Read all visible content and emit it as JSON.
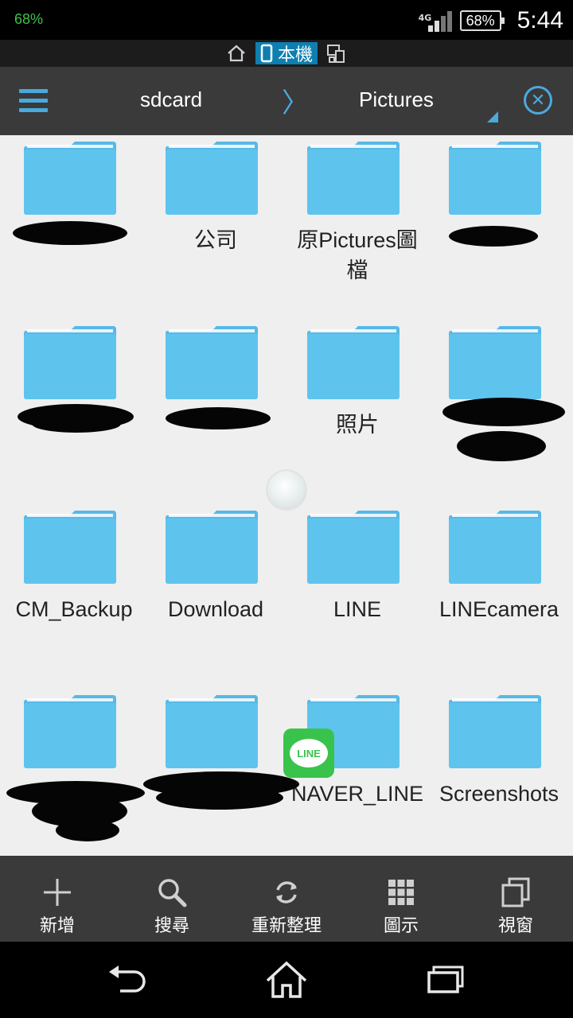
{
  "status_bar": {
    "left_battery": "68%",
    "network": "4G",
    "battery": "68%",
    "time": "5:44"
  },
  "window_bar": {
    "active_tab_label": "本機"
  },
  "toolbar": {
    "crumb_root": "sdcard",
    "crumb_separator": "〉",
    "crumb_current": "Pictures",
    "accent": "#4aa9dd"
  },
  "folders": [
    {
      "name": "",
      "redacted": true
    },
    {
      "name": "公司"
    },
    {
      "name": "原Pictures圖檔"
    },
    {
      "name": "",
      "redacted": true
    },
    {
      "name": "",
      "redacted": true
    },
    {
      "name": "",
      "redacted": true
    },
    {
      "name": "照片"
    },
    {
      "name": "",
      "redacted": true
    },
    {
      "name": "CM_Backup"
    },
    {
      "name": "Download"
    },
    {
      "name": "LINE"
    },
    {
      "name": "LINEcamera"
    },
    {
      "name": "",
      "redacted": true
    },
    {
      "name": "",
      "redacted": true
    },
    {
      "name": "NAVER_LINE",
      "badge": "LINE"
    },
    {
      "name": "Screenshots"
    }
  ],
  "bottom_bar": {
    "items": [
      {
        "label": "新增",
        "icon": "plus-icon"
      },
      {
        "label": "搜尋",
        "icon": "search-icon"
      },
      {
        "label": "重新整理",
        "icon": "refresh-icon"
      },
      {
        "label": "圖示",
        "icon": "grid-view-icon"
      },
      {
        "label": "視窗",
        "icon": "windows-icon"
      }
    ]
  },
  "colors": {
    "folder": "#5ec4ee",
    "folder_tab": "#57b9e6",
    "grid_background": "#efefef",
    "bar_background": "#3a3a3a"
  }
}
